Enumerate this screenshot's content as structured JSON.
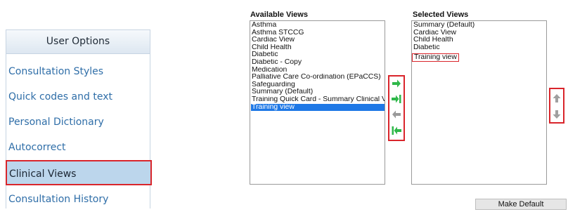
{
  "user_options": {
    "title": "User Options",
    "items": [
      {
        "label": "Consultation Styles"
      },
      {
        "label": "Quick codes and text"
      },
      {
        "label": "Personal Dictionary"
      },
      {
        "label": "Autocorrect"
      },
      {
        "label": "Clinical Views"
      },
      {
        "label": "Consultation History"
      }
    ],
    "selected": "Clinical Views"
  },
  "available_views": {
    "title": "Available Views",
    "items": [
      "Asthma",
      "Asthma STCCG",
      "Cardiac View",
      "Child Health",
      "Diabetic",
      "Diabetic - Copy",
      "Medication",
      "Palliative Care Co-ordination (EPaCCS)",
      "Safeguarding",
      "Summary (Default)",
      "Training Quick Card - Summary Clinical V",
      "Training view"
    ],
    "selected": "Training view"
  },
  "selected_views": {
    "title": "Selected Views",
    "items": [
      "Summary (Default)",
      "Cardiac View",
      "Child Health",
      "Diabetic",
      "Training view"
    ],
    "highlighted": "Training view"
  },
  "move_buttons": [
    {
      "icon": "arrow-right-icon",
      "color": "#2fb84a"
    },
    {
      "icon": "arrow-right-all-icon",
      "color": "#2fb84a"
    },
    {
      "icon": "arrow-left-icon",
      "color": "#9a9a9a"
    },
    {
      "icon": "arrow-left-all-icon",
      "color": "#2fb84a"
    }
  ],
  "order_buttons": [
    {
      "icon": "arrow-up-icon",
      "color": "#a0a0a0"
    },
    {
      "icon": "arrow-down-icon",
      "color": "#a0a0a0"
    }
  ],
  "make_default": {
    "label": "Make Default"
  },
  "colors": {
    "accent_red": "#d9252b",
    "selection_blue": "#1e78e6",
    "nav_text": "#2f6ea8"
  }
}
